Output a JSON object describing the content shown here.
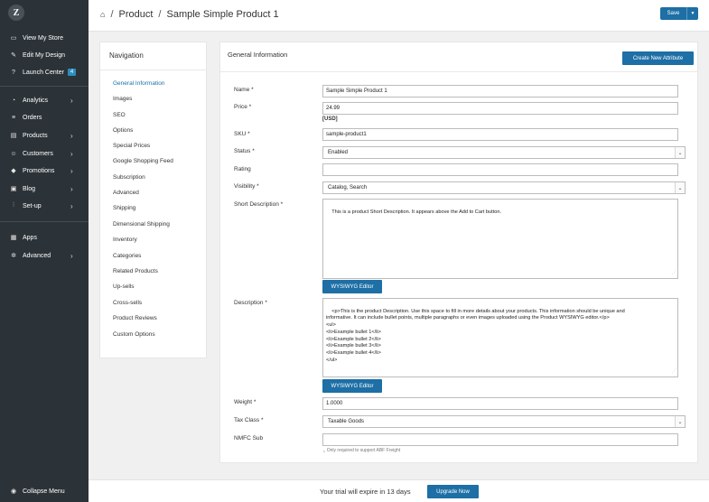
{
  "logo": {
    "letter": "Z"
  },
  "sidebar": {
    "top_items": [
      {
        "label": "View My Store",
        "icon": "monitor-icon"
      },
      {
        "label": "Edit My Design",
        "icon": "pencil-icon"
      },
      {
        "label": "Launch Center",
        "icon": "question-circle-icon",
        "badge": "4"
      }
    ],
    "menu_items": [
      {
        "label": "Analytics",
        "icon": "chart-icon",
        "has_submenu": true
      },
      {
        "label": "Orders",
        "icon": "database-icon",
        "has_submenu": false
      },
      {
        "label": "Products",
        "icon": "folder-icon",
        "has_submenu": true
      },
      {
        "label": "Customers",
        "icon": "users-icon",
        "has_submenu": true
      },
      {
        "label": "Promotions",
        "icon": "tag-icon",
        "has_submenu": true
      },
      {
        "label": "Blog",
        "icon": "blog-icon",
        "has_submenu": true
      },
      {
        "label": "Set-up",
        "icon": "sliders-icon",
        "has_submenu": true
      }
    ],
    "bottom_items": [
      {
        "label": "Apps",
        "icon": "apps-icon",
        "has_submenu": false
      },
      {
        "label": "Advanced",
        "icon": "gear-icon",
        "has_submenu": true
      }
    ],
    "collapse_label": "Collapse Menu"
  },
  "header": {
    "breadcrumb": [
      "Product",
      "Sample Simple Product 1"
    ],
    "save_label": "Save"
  },
  "nav_panel": {
    "title": "Navigation",
    "links": [
      {
        "label": "General Information",
        "active": true
      },
      {
        "label": "Images",
        "active": false
      },
      {
        "label": "SEO",
        "active": false
      },
      {
        "label": "Options",
        "active": false
      },
      {
        "label": "Special Prices",
        "active": false
      },
      {
        "label": "Google Shopping Feed",
        "active": false
      },
      {
        "label": "Subscription",
        "active": false
      },
      {
        "label": "Advanced",
        "active": false
      },
      {
        "label": "Shipping",
        "active": false
      },
      {
        "label": "Dimensional Shipping",
        "active": false
      },
      {
        "label": "Inventory",
        "active": false
      },
      {
        "label": "Categories",
        "active": false
      },
      {
        "label": "Related Products",
        "active": false
      },
      {
        "label": "Up-sells",
        "active": false
      },
      {
        "label": "Cross-sells",
        "active": false
      },
      {
        "label": "Product Reviews",
        "active": false
      },
      {
        "label": "Custom Options",
        "active": false
      }
    ]
  },
  "form": {
    "title": "General Information",
    "create_attribute_label": "Create New Attribute",
    "name": {
      "label": "Name *",
      "value": "Sample Simple Product 1"
    },
    "price": {
      "label": "Price *",
      "value": "24.99",
      "currency": "[USD]"
    },
    "sku": {
      "label": "SKU *",
      "value": "sample-product1"
    },
    "status": {
      "label": "Status *",
      "value": "Enabled"
    },
    "rating": {
      "label": "Rating",
      "value": ""
    },
    "visibility": {
      "label": "Visibility *",
      "value": "Catalog, Search"
    },
    "short_description": {
      "label": "Short Description *",
      "value": "This is a product Short Description. It appears above the Add to Cart button."
    },
    "wysiwyg_label": "WYSIWYG Editor",
    "description": {
      "label": "Description *",
      "value": "<p>This is the product Description. Use this space to fill in more details about your products. This information should be unique and\ninformative. It can include bullet points, multiple paragraphs or even images uploaded using the Product WYSIWYG editor.</p>\n<ul>\n<li>Example bullet 1</li>\n<li>Example bullet 2</li>\n<li>Example bullet 3</li>\n<li>Example bullet 4</li>\n</ul>"
    },
    "weight": {
      "label": "Weight *",
      "value": "1.0000"
    },
    "tax_class": {
      "label": "Tax Class *",
      "value": "Taxable Goods"
    },
    "nmfc_sub": {
      "label": "NMFC Sub",
      "value": "",
      "note": "Only required to support ABF Freight"
    }
  },
  "trial": {
    "text": "Your trial will expire in 13 days",
    "upgrade_label": "Upgrade Now"
  }
}
